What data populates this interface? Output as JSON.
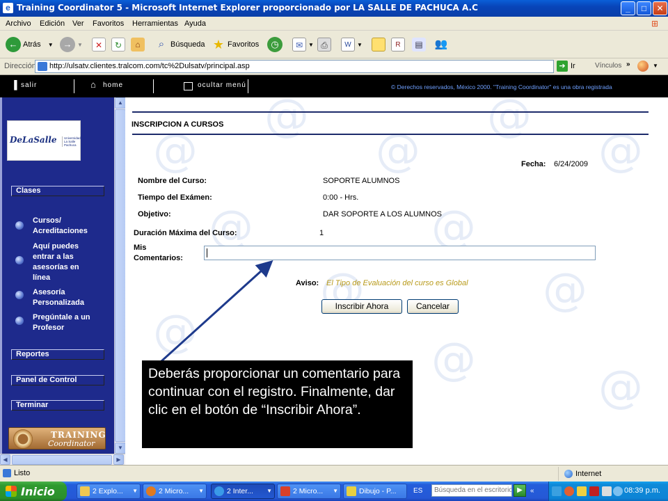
{
  "window": {
    "title": "Training Coordinator 5 - Microsoft Internet Explorer proporcionado por LA SALLE DE PACHUCA A.C",
    "min_label": "_",
    "max_label": "□",
    "close_label": "✕"
  },
  "menubar": {
    "items": [
      "Archivo",
      "Edición",
      "Ver",
      "Favoritos",
      "Herramientas",
      "Ayuda"
    ]
  },
  "toolbar": {
    "back_label": "Atrás",
    "search_label": "Búsqueda",
    "favorites_label": "Favoritos"
  },
  "addressbar": {
    "label": "Dirección",
    "url": "http://ulsatv.clientes.tralcom.com/tc%2Dulsatv/principal.asp",
    "go_label": "Ir",
    "links_label": "Vínculos"
  },
  "site_header": {
    "salir": "salir",
    "home": "home",
    "ocultar": "ocultar menú",
    "copyright": "© Derechos reservados, México 2000. \"Training Coordinator\" es una obra registrada"
  },
  "sidebar": {
    "logo_text": "DeLaSalle",
    "logo_subtext": "Universidad La Salle Pachuca",
    "sections": {
      "clases": "Clases",
      "reportes": "Reportes",
      "panel": "Panel de Control",
      "terminar": "Terminar"
    },
    "items": [
      {
        "line1": "Cursos/",
        "line2": "Acreditaciones"
      },
      {
        "line1": "Aquí puedes",
        "line2": "entrar a las",
        "line3": "asesorías en",
        "line4": "línea"
      },
      {
        "line1": "Asesoría",
        "line2": "Personalizada"
      },
      {
        "line1": "Pregúntale a un",
        "line2": "Profesor"
      }
    ],
    "bottom_logo": {
      "line1": "TRAINING",
      "line2": "Coordinator"
    }
  },
  "form": {
    "title": "INSCRIPCION A CURSOS",
    "fecha_label": "Fecha:",
    "fecha_value": "6/24/2009",
    "nombre_label": "Nombre del Curso:",
    "nombre_value": "SOPORTE ALUMNOS",
    "tiempo_label": "Tiempo del Exámen:",
    "tiempo_value": "0:00 - Hrs.",
    "objetivo_label": "Objetivo:",
    "objetivo_value": "DAR SOPORTE A LOS ALUMNOS",
    "duracion_label": "Duración Máxima del Curso:",
    "duracion_value": "1",
    "comentarios_label_1": "Mis",
    "comentarios_label_2": "Comentarios:",
    "comentarios_value": "",
    "aviso_label": "Aviso:",
    "aviso_text": "El Tipo de Evaluación del curso es Global",
    "inscribir_label": "Inscribir Ahora",
    "cancelar_label": "Cancelar"
  },
  "annotation": {
    "text": "Deberás  proporcionar un comentario para continuar con el registro. Finalmente, dar clic en el botón de “Inscribir Ahora”."
  },
  "statusbar": {
    "status": "Listo",
    "zone": "Internet"
  },
  "taskbar": {
    "start_label": "Inicio",
    "tasks": [
      "2 Explo...",
      "2 Micro...",
      "2 Inter...",
      "2 Micro...",
      "Dibujo - P..."
    ],
    "lang": "ES",
    "desktop_search_placeholder": "Búsqueda en el escritorio",
    "clock": "08:39 p.m."
  },
  "colors": {
    "sidebar_bg": "#1e2a8c",
    "header_bg": "#000000",
    "aviso_color": "#b89a1a",
    "xp_blue": "#245edb",
    "start_green": "#2f9a2f"
  }
}
